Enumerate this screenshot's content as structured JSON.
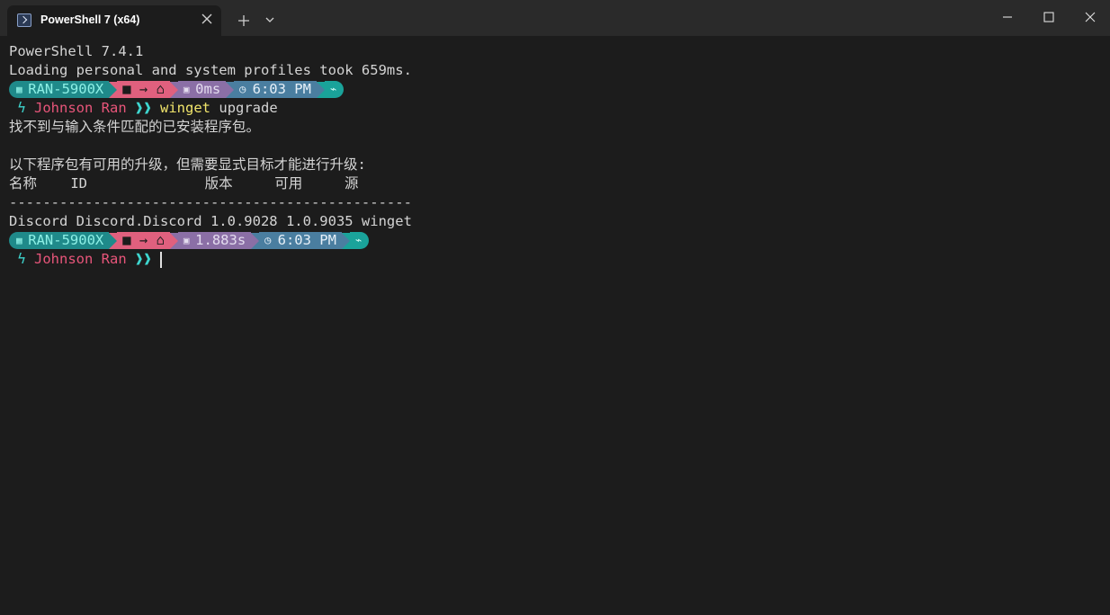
{
  "window": {
    "tab_title": "PowerShell 7 (x64)"
  },
  "terminal": {
    "banner": "PowerShell 7.4.1",
    "profile_load": "Loading personal and system profiles took 659ms.",
    "prompt1": {
      "host": "RAN-5900X",
      "path": "■ → ⌂",
      "duration": "0ms",
      "clock": "6:03 PM",
      "user": "Johnson Ran",
      "chevrons": "❱❱",
      "command": "winget",
      "args": "upgrade"
    },
    "out_no_match": "找不到与输入条件匹配的已安装程序包。",
    "out_blank": "",
    "out_upgrades": "以下程序包有可用的升级，但需要显式目标才能进行升级:",
    "table_header": "名称    ID              版本     可用     源",
    "table_rule": "------------------------------------------------",
    "table_row": "Discord Discord.Discord 1.0.9028 1.0.9035 winget",
    "prompt2": {
      "host": "RAN-5900X",
      "path": "■ → ⌂",
      "duration": "1.883s",
      "clock": "6:03 PM",
      "user": "Johnson Ran",
      "chevrons": "❱❱"
    }
  },
  "colors": {
    "background": "#1c1c1c",
    "titlebar": "#2a2a2a",
    "host_segment": "#1f8a8a",
    "path_segment": "#e0607e",
    "duration_segment": "#8b6fa6",
    "clock_segment": "#4a7ea0",
    "end_segment": "#1aa39a",
    "user_text": "#e8557a",
    "command_text": "#f1e56b"
  },
  "icons": [
    "powershell-icon",
    "close-icon",
    "plus-icon",
    "chevron-down-icon",
    "minimize-icon",
    "maximize-icon",
    "close-window-icon",
    "windows-grid-icon",
    "folder-icon",
    "home-icon",
    "timer-icon",
    "clock-icon",
    "pulse-icon",
    "lightning-icon"
  ]
}
